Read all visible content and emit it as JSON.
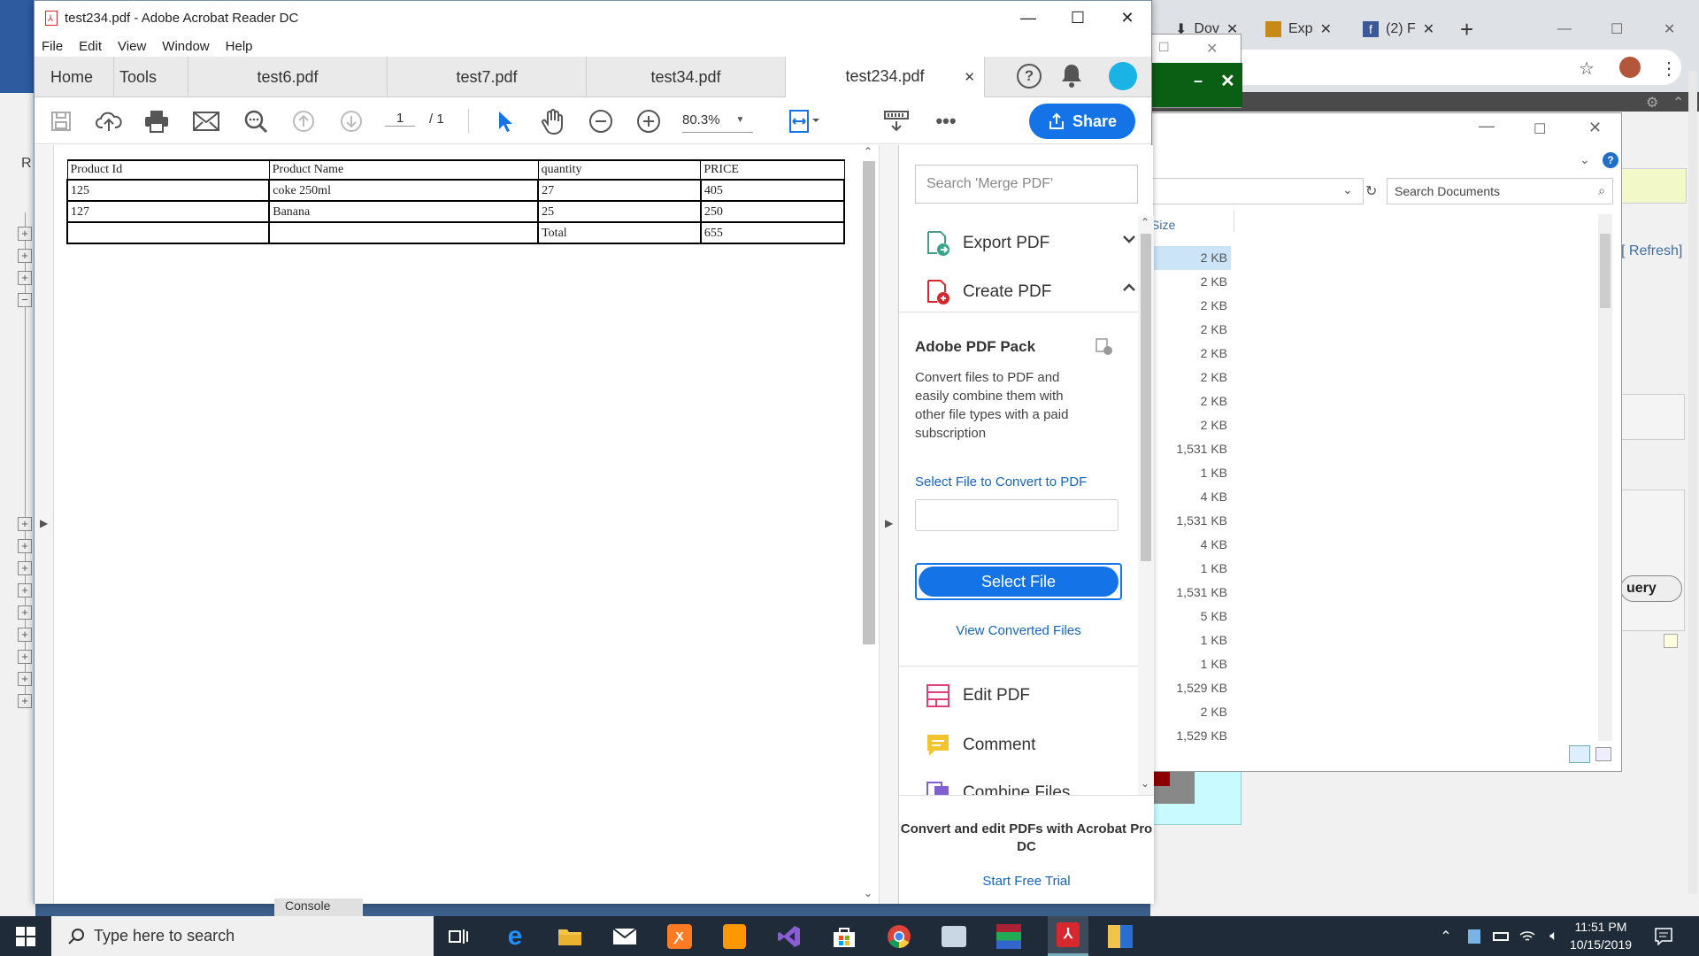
{
  "acrobat": {
    "title": "test234.pdf - Adobe Acrobat Reader DC",
    "menu": [
      "File",
      "Edit",
      "View",
      "Window",
      "Help"
    ],
    "tabs": {
      "home": "Home",
      "tools": "Tools",
      "doc1": "test6.pdf",
      "doc2": "test7.pdf",
      "doc3": "test34.pdf",
      "doc4": "test234.pdf"
    },
    "toolbar": {
      "page_current": "1",
      "page_total": "/ 1",
      "zoom": "80.3%",
      "share_label": "Share"
    },
    "table": {
      "headers": [
        "Product Id",
        "Product Name",
        "quantity",
        "PRICE"
      ],
      "rows": [
        [
          "125",
          "coke 250ml",
          "27",
          "405"
        ],
        [
          "127",
          "Banana",
          "25",
          "250"
        ],
        [
          "",
          "",
          "Total",
          "655"
        ]
      ]
    },
    "right_pane": {
      "search_placeholder": "Search 'Merge PDF'",
      "export_label": "Export PDF",
      "create_label": "Create PDF",
      "pack_title": "Adobe PDF Pack",
      "pack_desc": "Convert files to PDF and easily combine them with other file types with a paid subscription",
      "select_link": "Select File to Convert to PDF",
      "select_button": "Select File",
      "view_converted": "View Converted Files",
      "edit_label": "Edit PDF",
      "comment_label": "Comment",
      "combine_label": "Combine Files",
      "footer_text": "Convert and edit PDFs with Acrobat Pro DC",
      "trial_link": "Start Free Trial"
    }
  },
  "chrome": {
    "tab1": "Dov",
    "tab2": "Exp",
    "tab3": "(2) F"
  },
  "explorer": {
    "search_placeholder": "Search Documents",
    "size_header": "Size",
    "sizes": [
      "2 KB",
      "2 KB",
      "2 KB",
      "2 KB",
      "2 KB",
      "2 KB",
      "2 KB",
      "2 KB",
      "1,531 KB",
      "1 KB",
      "4 KB",
      "1,531 KB",
      "4 KB",
      "1 KB",
      "1,531 KB",
      "5 KB",
      "1 KB",
      "1 KB",
      "1,529 KB",
      "2 KB",
      "1,529 KB"
    ]
  },
  "background": {
    "refresh_label": "[ Refresh]",
    "query_label": "uery",
    "console_label": "Console",
    "left_letter": "R"
  },
  "taskbar": {
    "search_text": "Type here to search",
    "time": "11:51 PM",
    "date": "10/15/2019"
  },
  "colors": {
    "accent": "#1473e6",
    "acrobat_red": "#d7282f",
    "taskbar": "#1f2b38"
  }
}
